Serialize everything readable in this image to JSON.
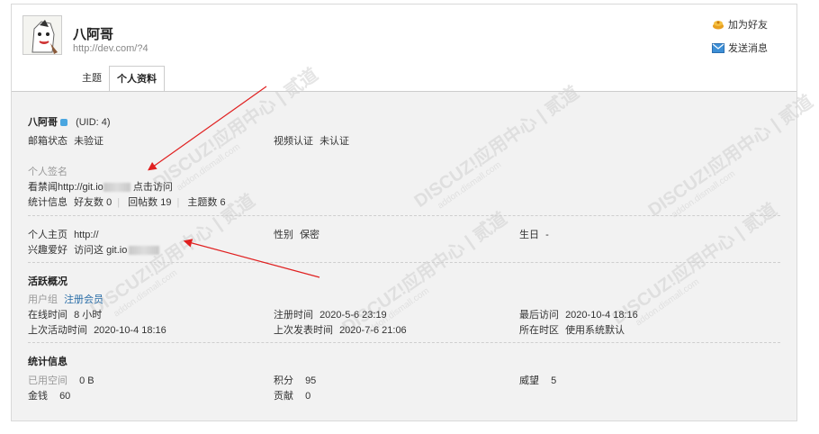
{
  "profile": {
    "name": "八阿哥",
    "url": "http://dev.com/?4"
  },
  "actions": {
    "add_friend": "加为好友",
    "send_message": "发送消息"
  },
  "tabs": [
    "主题",
    "个人资料"
  ],
  "basic": {
    "name": "八阿哥",
    "uid": "(UID: 4)",
    "email_label": "邮箱状态",
    "email_value": "未验证",
    "video_label": "视频认证",
    "video_value": "未认证",
    "signature_label": "个人签名",
    "signature_prefix": "看禁闻http://git.io",
    "signature_suffix": "点击访问",
    "stats_label": "统计信息",
    "friends": "好友数 0",
    "replies": "回帖数 19",
    "threads": "主题数 6"
  },
  "info": {
    "homepage_label": "个人主页",
    "homepage_value": "http://",
    "gender_label": "性别",
    "gender_value": "保密",
    "birthday_label": "生日",
    "birthday_value": "-",
    "hobby_label": "兴趣爱好",
    "hobby_value": "访问这 git.io"
  },
  "activity": {
    "title": "活跃概况",
    "group_label": "用户组",
    "group_value": "注册会员",
    "online_label": "在线时间",
    "online_value": "8 小时",
    "reg_label": "注册时间",
    "reg_value": "2020-5-6 23:19",
    "lastvisit_label": "最后访问",
    "lastvisit_value": "2020-10-4 18:16",
    "lastactive_label": "上次活动时间",
    "lastactive_value": "2020-10-4 18:16",
    "lastpost_label": "上次发表时间",
    "lastpost_value": "2020-7-6 21:06",
    "timezone_label": "所在时区",
    "timezone_value": "使用系统默认"
  },
  "stats": {
    "title": "统计信息",
    "space_label": "已用空间",
    "space_value": "0 B",
    "credits_label": "积分",
    "credits_value": "95",
    "prestige_label": "威望",
    "prestige_value": "5",
    "money_label": "金钱",
    "money_value": "60",
    "contrib_label": "贡献",
    "contrib_value": "0"
  },
  "watermark": {
    "main": "DISCUZ!应用中心 | 贰道",
    "sub": "addon.dismall.com"
  },
  "colors": {
    "link": "#2b6ea8",
    "arrow": "#e02020",
    "panel_bg": "#f2f2f2"
  }
}
